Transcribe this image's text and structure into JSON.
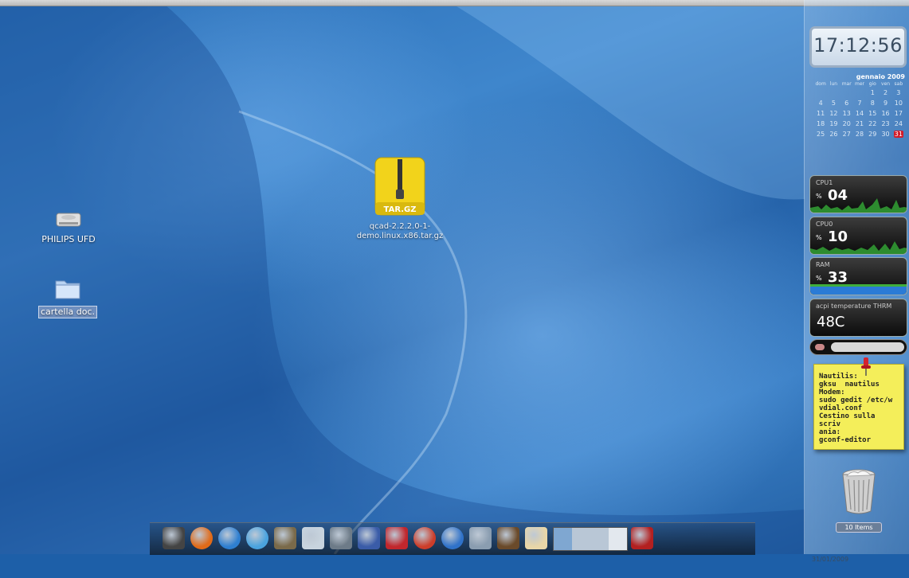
{
  "desktop": {
    "icons": [
      {
        "label": "PHILIPS UFD",
        "icon": "drive-icon"
      },
      {
        "label": "cartella doc.",
        "icon": "folder-icon"
      },
      {
        "label": "qcad-2.2.2.0-1-demo.linux.x86.tar.gz",
        "icon": "archive-icon",
        "badge": "TAR.GZ"
      }
    ]
  },
  "clock": {
    "time": "17:12:56",
    "date": "31/01/2009"
  },
  "calendar": {
    "month": "gennaio 2009",
    "days_of_week": [
      "dom",
      "lun",
      "mar",
      "mer",
      "gio",
      "ven",
      "sab"
    ],
    "weeks": [
      [
        "",
        "",
        "",
        "",
        "1",
        "2",
        "3"
      ],
      [
        "4",
        "5",
        "6",
        "7",
        "8",
        "9",
        "10"
      ],
      [
        "11",
        "12",
        "13",
        "14",
        "15",
        "16",
        "17"
      ],
      [
        "18",
        "19",
        "20",
        "21",
        "22",
        "23",
        "24"
      ],
      [
        "25",
        "26",
        "27",
        "28",
        "29",
        "30",
        "31"
      ]
    ],
    "today": "31",
    "today_color": "#d21b2a"
  },
  "meters": {
    "cpu1": {
      "name": "CPU1",
      "unit": "%",
      "value": "04",
      "graph_color": "#2d8c2f"
    },
    "cpu0": {
      "name": "CPU0",
      "unit": "%",
      "value": "10",
      "graph_color": "#2d8c2f"
    },
    "ram": {
      "name": "RAM",
      "unit": "%",
      "value": "33",
      "graph_color": "#2a7bd6"
    },
    "temp": {
      "name": "acpi temperature THRM",
      "value": "48C"
    }
  },
  "sticky_note": {
    "lines": [
      "Nautilis:",
      "gksu  nautilus",
      "Modem:",
      "sudo gedit /etc/w",
      "vdial.conf",
      "Cestino sulla scriv",
      "ania:",
      "gconf-editor"
    ]
  },
  "trash": {
    "count_label": "10 Items"
  },
  "dock": {
    "items": [
      "phone-icon",
      "firefox-icon",
      "internet-explorer-icon",
      "network-icon",
      "gimp-icon",
      "camera-icon",
      "calculator-icon",
      "terminal-icon",
      "filezilla-icon",
      "app-icon",
      "music-icon",
      "document-icon",
      "movie-icon",
      "text-editor-icon",
      "workspace-switcher-icon",
      "exit-icon"
    ]
  }
}
